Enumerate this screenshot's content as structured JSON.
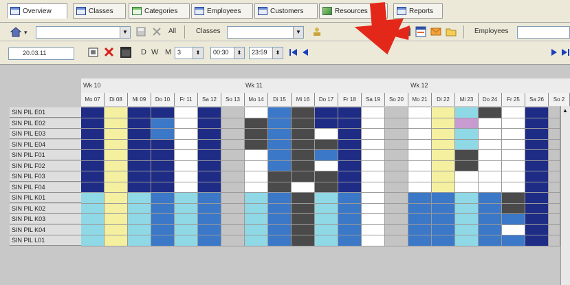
{
  "tabs": [
    {
      "label": "Overview",
      "icon": "table-icon",
      "active": true
    },
    {
      "label": "Classes",
      "icon": "table-icon",
      "active": false
    },
    {
      "label": "Categories",
      "icon": "grid-icon",
      "active": false
    },
    {
      "label": "Employees",
      "icon": "table-icon",
      "active": false
    },
    {
      "label": "Customers",
      "icon": "table-icon",
      "active": false
    },
    {
      "label": "Resources",
      "icon": "cube-icon",
      "active": false
    },
    {
      "label": "Reports",
      "icon": "table-icon",
      "active": false
    }
  ],
  "toolbar": {
    "all_label": "All",
    "classes_label": "Classes",
    "employees_label": "Employees",
    "date_value": "20.03.11",
    "view_day": "D",
    "view_week": "W",
    "view_month": "M",
    "count_value": "3",
    "start_time": "00:30",
    "end_time": "23:59"
  },
  "calendar": {
    "weeks": [
      "Wk 10",
      "Wk 11",
      "Wk 12"
    ],
    "days": [
      "Mo 07",
      "Di 08",
      "Mi 09",
      "Do 10",
      "Fr 11",
      "Sa 12",
      "So 13",
      "Mo 14",
      "Di 15",
      "Mi 16",
      "Do 17",
      "Fr 18",
      "Sa 19",
      "So 20",
      "Mo 21",
      "Di 22",
      "Mi 23",
      "Do 24",
      "Fr 25",
      "Sa 26",
      "So 2"
    ],
    "rows": [
      "SIN PIL E01",
      "SIN PIL E02",
      "SIN PIL E03",
      "SIN PIL E04",
      "SIN PIL F01",
      "SIN PIL F02",
      "SIN PIL F03",
      "SIN PIL F04",
      "SIN PIL K01",
      "SIN PIL K02",
      "SIN PIL K03",
      "SIN PIL K04",
      "SIN PIL L01"
    ]
  },
  "colors": {
    "navy": "#1e2c86",
    "mid_blue": "#3b78c8",
    "light_cyan": "#8fd8e6",
    "yellow": "#f4f0a0",
    "dark_grey": "#4a4a4a",
    "white": "#ffffff",
    "grey": "#c4c4c4",
    "pink": "#c79ad0",
    "arrow_red": "#e32718"
  }
}
